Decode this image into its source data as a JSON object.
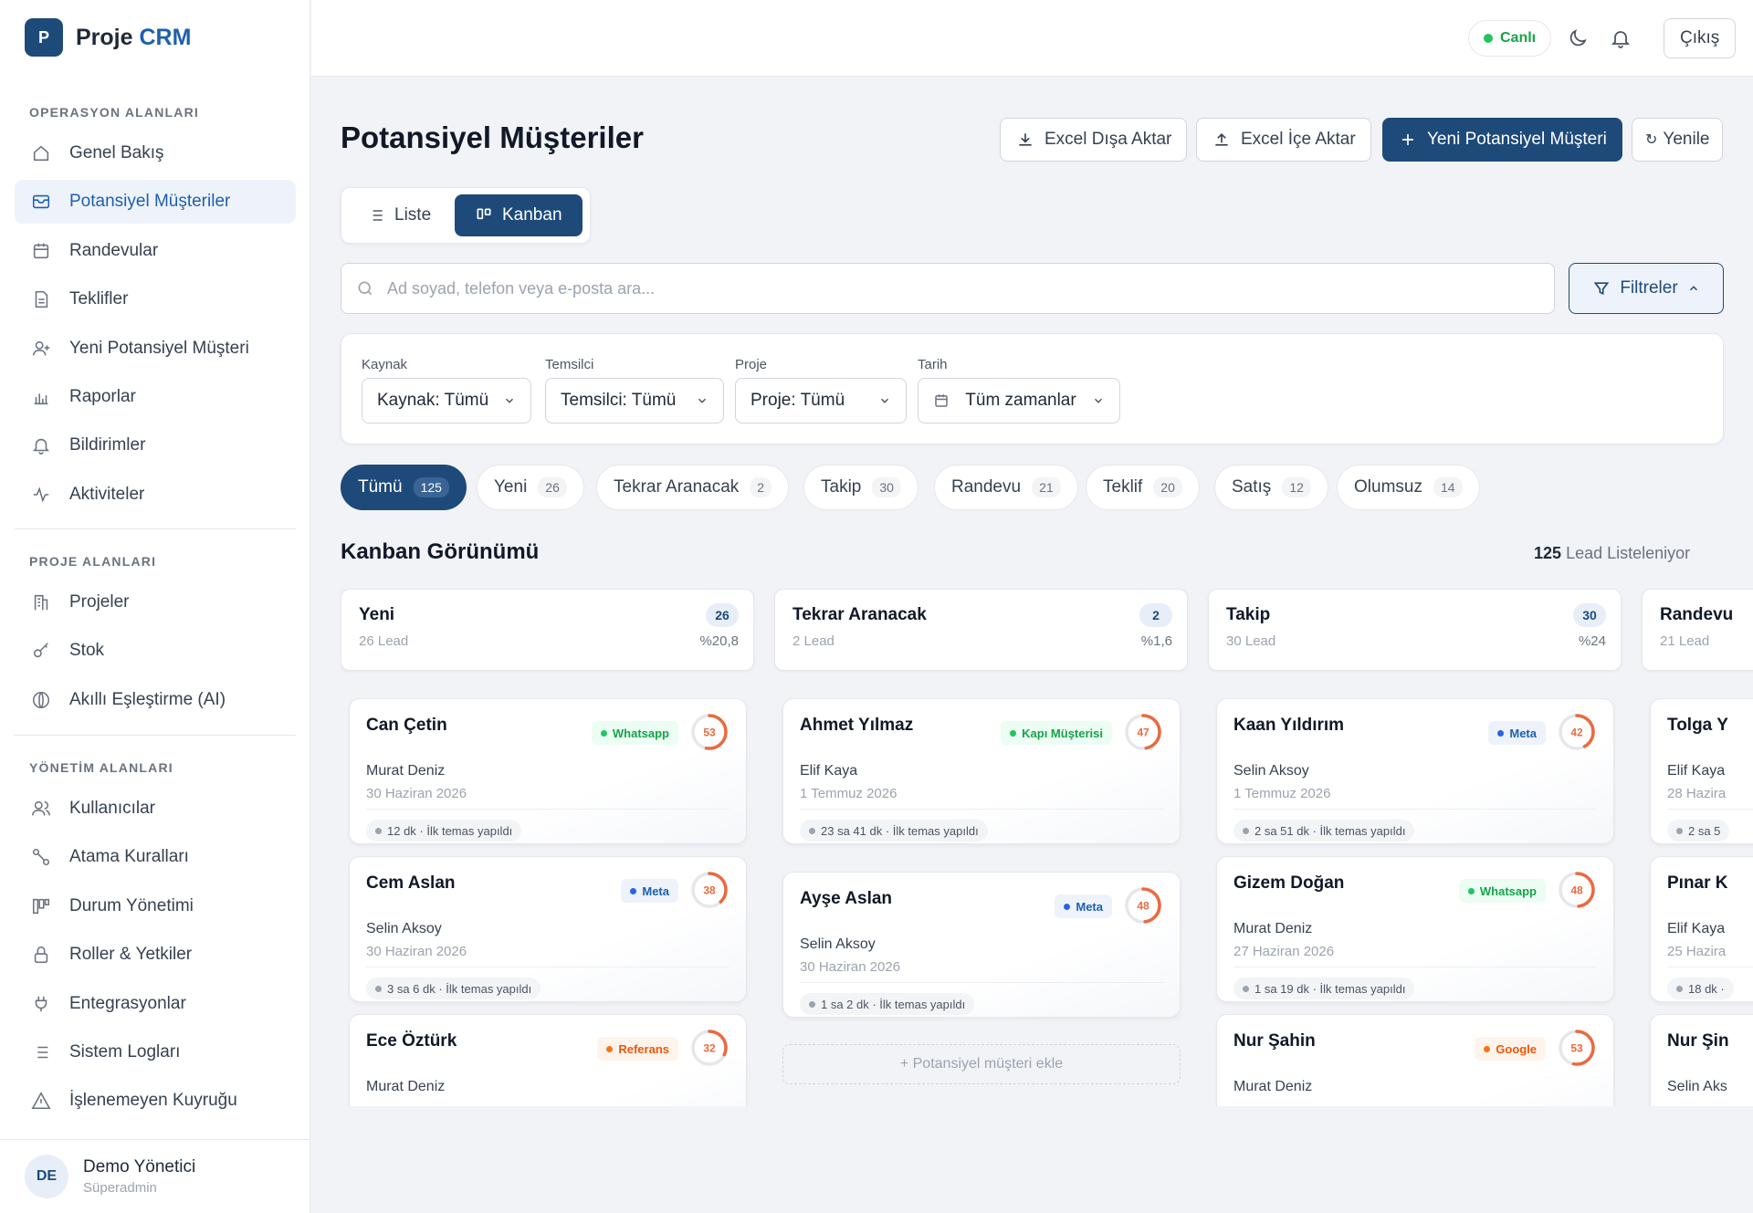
{
  "brand": {
    "logo_letter": "P",
    "name": "Proje",
    "accent": "CRM"
  },
  "sidebar": {
    "sections": [
      "OPERASYON ALANLARI",
      "PROJE ALANLARI",
      "YÖNETİM ALANLARI"
    ],
    "operations": [
      {
        "label": "Genel Bakış",
        "icon": "home-icon"
      },
      {
        "label": "Potansiyel Müşteriler",
        "icon": "inbox-icon",
        "active": true
      },
      {
        "label": "Randevular",
        "icon": "calendar-icon"
      },
      {
        "label": "Teklifler",
        "icon": "document-icon"
      },
      {
        "label": "Yeni Potansiyel Müşteri",
        "icon": "user-plus-icon"
      },
      {
        "label": "Raporlar",
        "icon": "bar-chart-icon"
      },
      {
        "label": "Bildirimler",
        "icon": "bell-icon"
      },
      {
        "label": "Aktiviteler",
        "icon": "activity-icon"
      }
    ],
    "projects": [
      {
        "label": "Projeler",
        "icon": "building-icon"
      },
      {
        "label": "Stok",
        "icon": "key-icon"
      },
      {
        "label": "Akıllı Eşleştirme (AI)",
        "icon": "ai-icon"
      }
    ],
    "management": [
      {
        "label": "Kullanıcılar",
        "icon": "users-icon"
      },
      {
        "label": "Atama Kuralları",
        "icon": "route-icon"
      },
      {
        "label": "Durum Yönetimi",
        "icon": "kanban-icon"
      },
      {
        "label": "Roller & Yetkiler",
        "icon": "lock-icon"
      },
      {
        "label": "Entegrasyonlar",
        "icon": "plug-icon"
      },
      {
        "label": "Sistem Logları",
        "icon": "list-icon"
      },
      {
        "label": "İşlenemeyen Kuyruğu",
        "icon": "warning-icon"
      }
    ],
    "user": {
      "initials": "DE",
      "name": "Demo Yönetici",
      "role": "Süperadmin"
    }
  },
  "topbar": {
    "live": "Canlı",
    "logout": "Çıkış"
  },
  "header": {
    "title": "Potansiyel Müşteriler",
    "export": "Excel Dışa Aktar",
    "import": "Excel İçe Aktar",
    "new_lead": "Yeni Potansiyel Müşteri",
    "refresh": "Yenile"
  },
  "view_toggle": {
    "list": "Liste",
    "kanban": "Kanban",
    "active": "Kanban"
  },
  "search": {
    "placeholder": "Ad soyad, telefon veya e-posta ara...",
    "filters": "Filtreler"
  },
  "filters": [
    {
      "label": "Kaynak",
      "value": "Kaynak: Tümü"
    },
    {
      "label": "Temsilci",
      "value": "Temsilci: Tümü"
    },
    {
      "label": "Proje",
      "value": "Proje: Tümü"
    },
    {
      "label": "Tarih",
      "value": "Tüm zamanlar"
    }
  ],
  "status_tabs": [
    {
      "label": "Tümü",
      "count": "125",
      "active": true
    },
    {
      "label": "Yeni",
      "count": "26"
    },
    {
      "label": "Tekrar Aranacak",
      "count": "2"
    },
    {
      "label": "Takip",
      "count": "30"
    },
    {
      "label": "Randevu",
      "count": "21"
    },
    {
      "label": "Teklif",
      "count": "20"
    },
    {
      "label": "Satış",
      "count": "12"
    },
    {
      "label": "Olumsuz",
      "count": "14"
    }
  ],
  "kanban": {
    "title": "Kanban Görünümü",
    "count": "125",
    "count_suffix": "Lead Listeleniyor",
    "add_lead": "+ Potansiyel müşteri ekle",
    "columns": [
      {
        "title": "Yeni",
        "sub": "26 Lead",
        "badge": "26",
        "pct": "%20,8",
        "cards": [
          {
            "name": "Can Çetin",
            "source": "Whatsapp",
            "src_class": "src-whatsapp",
            "score": 53,
            "agent": "Murat Deniz",
            "date": "30 Haziran 2026",
            "activity": "12 dk · İlk temas yapıldı"
          },
          {
            "name": "Cem Aslan",
            "source": "Meta",
            "src_class": "src-meta",
            "score": 38,
            "agent": "Selin Aksoy",
            "date": "30 Haziran 2026",
            "activity": "3 sa 6 dk · İlk temas yapıldı"
          },
          {
            "name": "Ece Öztürk",
            "source": "Referans",
            "src_class": "src-ref",
            "score": 32,
            "agent": "Murat Deniz",
            "date": "",
            "activity": ""
          }
        ]
      },
      {
        "title": "Tekrar Aranacak",
        "sub": "2 Lead",
        "badge": "2",
        "pct": "%1,6",
        "cards": [
          {
            "name": "Ahmet Yılmaz",
            "source": "Kapı Müşterisi",
            "src_class": "src-whatsapp",
            "score": 47,
            "agent": "Elif Kaya",
            "date": "1 Temmuz 2026",
            "activity": "23 sa 41 dk · İlk temas yapıldı"
          },
          {
            "name": "Ayşe Aslan",
            "source": "Meta",
            "src_class": "src-meta",
            "score": 48,
            "agent": "Selin Aksoy",
            "date": "30 Haziran 2026",
            "activity": "1 sa 2 dk · İlk temas yapıldı"
          }
        ]
      },
      {
        "title": "Takip",
        "sub": "30 Lead",
        "badge": "30",
        "pct": "%24",
        "cards": [
          {
            "name": "Kaan Yıldırım",
            "source": "Meta",
            "src_class": "src-meta",
            "score": 42,
            "agent": "Selin Aksoy",
            "date": "1 Temmuz 2026",
            "activity": "2 sa 51 dk · İlk temas yapıldı"
          },
          {
            "name": "Gizem Doğan",
            "source": "Whatsapp",
            "src_class": "src-whatsapp",
            "score": 48,
            "agent": "Murat Deniz",
            "date": "27 Haziran 2026",
            "activity": "1 sa 19 dk · İlk temas yapıldı"
          },
          {
            "name": "Nur Şahin",
            "source": "Google",
            "src_class": "src-google",
            "score": 53,
            "agent": "Murat Deniz",
            "date": "",
            "activity": ""
          }
        ]
      },
      {
        "title": "Randevu",
        "sub": "21 Lead",
        "badge": "",
        "pct": "",
        "cards": [
          {
            "name": "Tolga Y",
            "source": "",
            "src_class": "",
            "score": null,
            "agent": "Elif Kaya",
            "date": "28 Hazira",
            "activity": "2 sa 5"
          },
          {
            "name": "Pınar K",
            "source": "",
            "src_class": "",
            "score": null,
            "agent": "Elif Kaya",
            "date": "25 Hazira",
            "activity": "18 dk ·"
          },
          {
            "name": "Nur Şin",
            "source": "",
            "src_class": "",
            "score": null,
            "agent": "Selin Aks",
            "date": "",
            "activity": ""
          }
        ]
      }
    ]
  },
  "colors": {
    "primary": "#1e4a7a",
    "accent": "#1e5fb0",
    "score": "#ea6a3f",
    "live": "#22c55e"
  }
}
